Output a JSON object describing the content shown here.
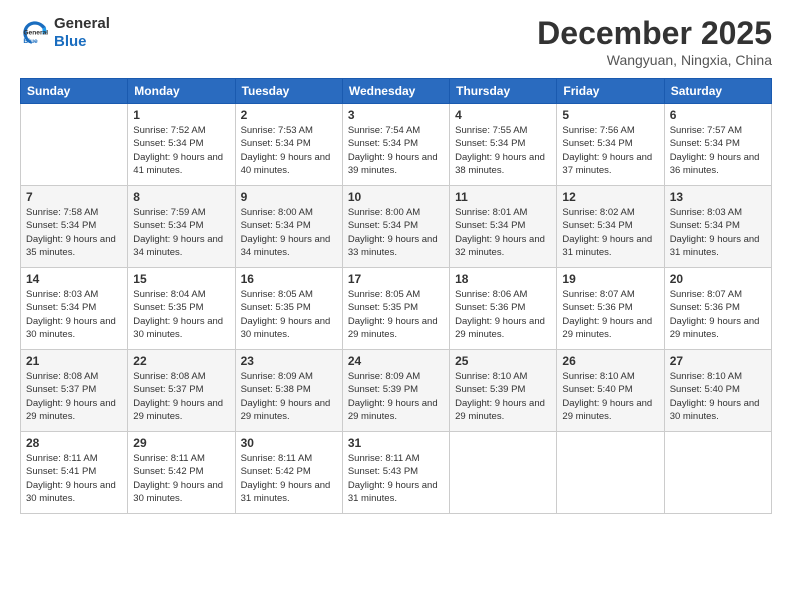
{
  "logo": {
    "line1": "General",
    "line2": "Blue"
  },
  "title": "December 2025",
  "location": "Wangyuan, Ningxia, China",
  "weekdays": [
    "Sunday",
    "Monday",
    "Tuesday",
    "Wednesday",
    "Thursday",
    "Friday",
    "Saturday"
  ],
  "weeks": [
    [
      {
        "day": "",
        "sunrise": "",
        "sunset": "",
        "daylight": ""
      },
      {
        "day": "1",
        "sunrise": "Sunrise: 7:52 AM",
        "sunset": "Sunset: 5:34 PM",
        "daylight": "Daylight: 9 hours and 41 minutes."
      },
      {
        "day": "2",
        "sunrise": "Sunrise: 7:53 AM",
        "sunset": "Sunset: 5:34 PM",
        "daylight": "Daylight: 9 hours and 40 minutes."
      },
      {
        "day": "3",
        "sunrise": "Sunrise: 7:54 AM",
        "sunset": "Sunset: 5:34 PM",
        "daylight": "Daylight: 9 hours and 39 minutes."
      },
      {
        "day": "4",
        "sunrise": "Sunrise: 7:55 AM",
        "sunset": "Sunset: 5:34 PM",
        "daylight": "Daylight: 9 hours and 38 minutes."
      },
      {
        "day": "5",
        "sunrise": "Sunrise: 7:56 AM",
        "sunset": "Sunset: 5:34 PM",
        "daylight": "Daylight: 9 hours and 37 minutes."
      },
      {
        "day": "6",
        "sunrise": "Sunrise: 7:57 AM",
        "sunset": "Sunset: 5:34 PM",
        "daylight": "Daylight: 9 hours and 36 minutes."
      }
    ],
    [
      {
        "day": "7",
        "sunrise": "Sunrise: 7:58 AM",
        "sunset": "Sunset: 5:34 PM",
        "daylight": "Daylight: 9 hours and 35 minutes."
      },
      {
        "day": "8",
        "sunrise": "Sunrise: 7:59 AM",
        "sunset": "Sunset: 5:34 PM",
        "daylight": "Daylight: 9 hours and 34 minutes."
      },
      {
        "day": "9",
        "sunrise": "Sunrise: 8:00 AM",
        "sunset": "Sunset: 5:34 PM",
        "daylight": "Daylight: 9 hours and 34 minutes."
      },
      {
        "day": "10",
        "sunrise": "Sunrise: 8:00 AM",
        "sunset": "Sunset: 5:34 PM",
        "daylight": "Daylight: 9 hours and 33 minutes."
      },
      {
        "day": "11",
        "sunrise": "Sunrise: 8:01 AM",
        "sunset": "Sunset: 5:34 PM",
        "daylight": "Daylight: 9 hours and 32 minutes."
      },
      {
        "day": "12",
        "sunrise": "Sunrise: 8:02 AM",
        "sunset": "Sunset: 5:34 PM",
        "daylight": "Daylight: 9 hours and 31 minutes."
      },
      {
        "day": "13",
        "sunrise": "Sunrise: 8:03 AM",
        "sunset": "Sunset: 5:34 PM",
        "daylight": "Daylight: 9 hours and 31 minutes."
      }
    ],
    [
      {
        "day": "14",
        "sunrise": "Sunrise: 8:03 AM",
        "sunset": "Sunset: 5:34 PM",
        "daylight": "Daylight: 9 hours and 30 minutes."
      },
      {
        "day": "15",
        "sunrise": "Sunrise: 8:04 AM",
        "sunset": "Sunset: 5:35 PM",
        "daylight": "Daylight: 9 hours and 30 minutes."
      },
      {
        "day": "16",
        "sunrise": "Sunrise: 8:05 AM",
        "sunset": "Sunset: 5:35 PM",
        "daylight": "Daylight: 9 hours and 30 minutes."
      },
      {
        "day": "17",
        "sunrise": "Sunrise: 8:05 AM",
        "sunset": "Sunset: 5:35 PM",
        "daylight": "Daylight: 9 hours and 29 minutes."
      },
      {
        "day": "18",
        "sunrise": "Sunrise: 8:06 AM",
        "sunset": "Sunset: 5:36 PM",
        "daylight": "Daylight: 9 hours and 29 minutes."
      },
      {
        "day": "19",
        "sunrise": "Sunrise: 8:07 AM",
        "sunset": "Sunset: 5:36 PM",
        "daylight": "Daylight: 9 hours and 29 minutes."
      },
      {
        "day": "20",
        "sunrise": "Sunrise: 8:07 AM",
        "sunset": "Sunset: 5:36 PM",
        "daylight": "Daylight: 9 hours and 29 minutes."
      }
    ],
    [
      {
        "day": "21",
        "sunrise": "Sunrise: 8:08 AM",
        "sunset": "Sunset: 5:37 PM",
        "daylight": "Daylight: 9 hours and 29 minutes."
      },
      {
        "day": "22",
        "sunrise": "Sunrise: 8:08 AM",
        "sunset": "Sunset: 5:37 PM",
        "daylight": "Daylight: 9 hours and 29 minutes."
      },
      {
        "day": "23",
        "sunrise": "Sunrise: 8:09 AM",
        "sunset": "Sunset: 5:38 PM",
        "daylight": "Daylight: 9 hours and 29 minutes."
      },
      {
        "day": "24",
        "sunrise": "Sunrise: 8:09 AM",
        "sunset": "Sunset: 5:39 PM",
        "daylight": "Daylight: 9 hours and 29 minutes."
      },
      {
        "day": "25",
        "sunrise": "Sunrise: 8:10 AM",
        "sunset": "Sunset: 5:39 PM",
        "daylight": "Daylight: 9 hours and 29 minutes."
      },
      {
        "day": "26",
        "sunrise": "Sunrise: 8:10 AM",
        "sunset": "Sunset: 5:40 PM",
        "daylight": "Daylight: 9 hours and 29 minutes."
      },
      {
        "day": "27",
        "sunrise": "Sunrise: 8:10 AM",
        "sunset": "Sunset: 5:40 PM",
        "daylight": "Daylight: 9 hours and 30 minutes."
      }
    ],
    [
      {
        "day": "28",
        "sunrise": "Sunrise: 8:11 AM",
        "sunset": "Sunset: 5:41 PM",
        "daylight": "Daylight: 9 hours and 30 minutes."
      },
      {
        "day": "29",
        "sunrise": "Sunrise: 8:11 AM",
        "sunset": "Sunset: 5:42 PM",
        "daylight": "Daylight: 9 hours and 30 minutes."
      },
      {
        "day": "30",
        "sunrise": "Sunrise: 8:11 AM",
        "sunset": "Sunset: 5:42 PM",
        "daylight": "Daylight: 9 hours and 31 minutes."
      },
      {
        "day": "31",
        "sunrise": "Sunrise: 8:11 AM",
        "sunset": "Sunset: 5:43 PM",
        "daylight": "Daylight: 9 hours and 31 minutes."
      },
      {
        "day": "",
        "sunrise": "",
        "sunset": "",
        "daylight": ""
      },
      {
        "day": "",
        "sunrise": "",
        "sunset": "",
        "daylight": ""
      },
      {
        "day": "",
        "sunrise": "",
        "sunset": "",
        "daylight": ""
      }
    ]
  ]
}
